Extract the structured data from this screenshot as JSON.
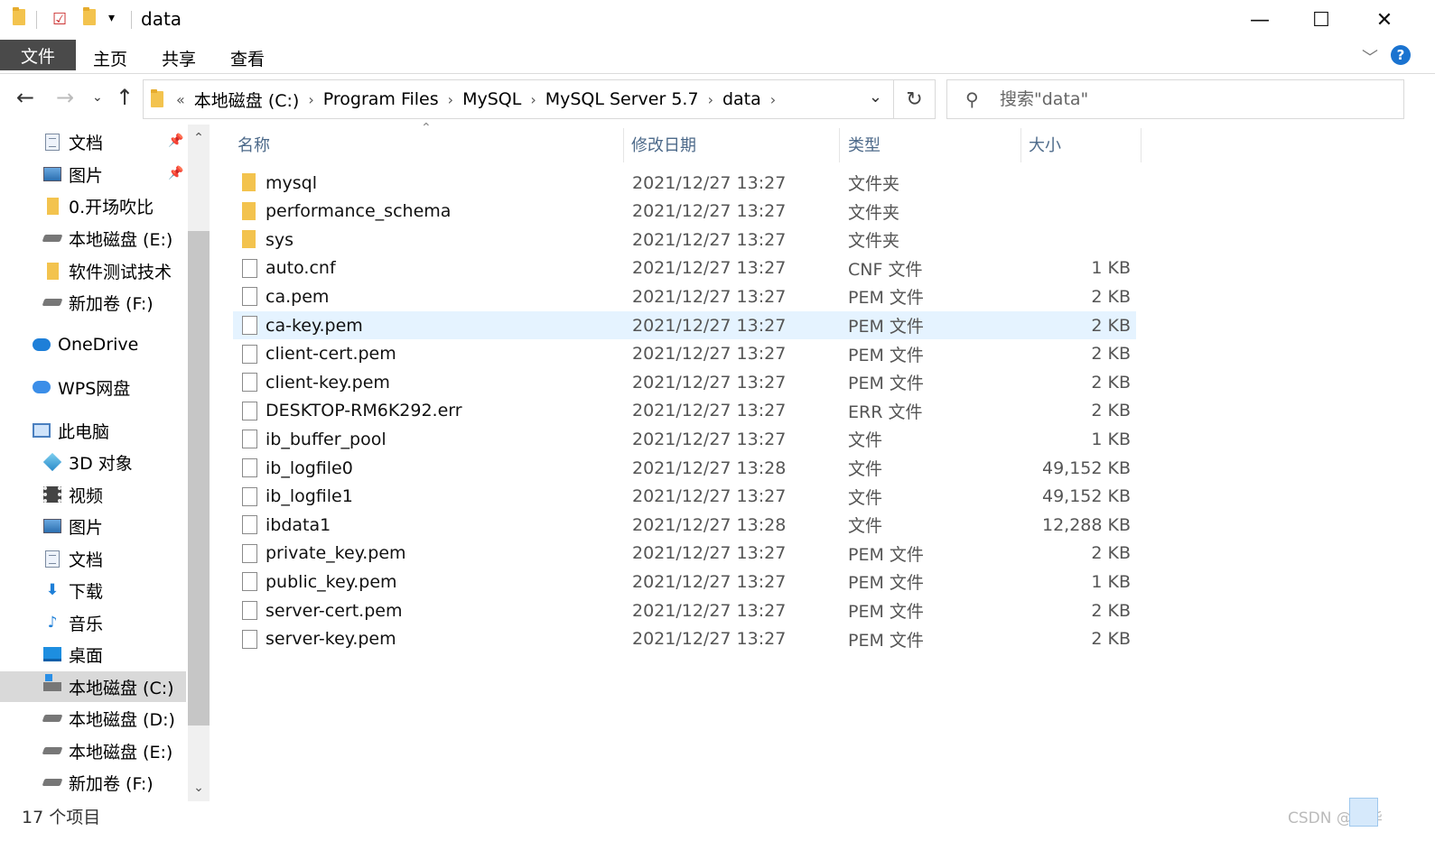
{
  "window": {
    "title": "data",
    "minimize_glyph": "—",
    "maximize_glyph": "☐",
    "close_glyph": "✕"
  },
  "ribbon": {
    "tabs": [
      "文件",
      "主页",
      "共享",
      "查看"
    ],
    "help_label": "?"
  },
  "nav": {
    "address_prefix": "«",
    "breadcrumb": [
      "本地磁盘 (C:)",
      "Program Files",
      "MySQL",
      "MySQL Server 5.7",
      "data"
    ],
    "search_placeholder": "搜索\"data\""
  },
  "sidebar": {
    "items": [
      {
        "label": "文档",
        "icon": "document-icon",
        "pinned": true
      },
      {
        "label": "图片",
        "icon": "pictures-icon",
        "pinned": true
      },
      {
        "label": "0.开场吹比",
        "icon": "folder-icon"
      },
      {
        "label": "本地磁盘 (E:)",
        "icon": "drive-icon"
      },
      {
        "label": "软件测试技术",
        "icon": "folder-icon"
      },
      {
        "label": "新加卷 (F:)",
        "icon": "drive-icon"
      },
      {
        "label": "OneDrive",
        "icon": "onedrive-cloud-icon"
      },
      {
        "label": "WPS网盘",
        "icon": "wps-cloud-icon"
      },
      {
        "label": "此电脑",
        "icon": "this-pc-icon"
      },
      {
        "label": "3D 对象",
        "icon": "3d-objects-icon"
      },
      {
        "label": "视频",
        "icon": "video-icon"
      },
      {
        "label": "图片",
        "icon": "pictures-icon"
      },
      {
        "label": "文档",
        "icon": "document-icon"
      },
      {
        "label": "下载",
        "icon": "download-icon"
      },
      {
        "label": "音乐",
        "icon": "music-icon"
      },
      {
        "label": "桌面",
        "icon": "desktop-icon"
      },
      {
        "label": "本地磁盘 (C:)",
        "icon": "windows-drive-icon",
        "selected": true
      },
      {
        "label": "本地磁盘 (D:)",
        "icon": "drive-icon"
      },
      {
        "label": "本地磁盘 (E:)",
        "icon": "drive-icon"
      },
      {
        "label": "新加卷 (F:)",
        "icon": "drive-icon"
      }
    ]
  },
  "columns": {
    "name": "名称",
    "date": "修改日期",
    "type": "类型",
    "size": "大小"
  },
  "files": [
    {
      "name": "mysql",
      "date": "2021/12/27 13:27",
      "type": "文件夹",
      "size": "",
      "kind": "folder"
    },
    {
      "name": "performance_schema",
      "date": "2021/12/27 13:27",
      "type": "文件夹",
      "size": "",
      "kind": "folder"
    },
    {
      "name": "sys",
      "date": "2021/12/27 13:27",
      "type": "文件夹",
      "size": "",
      "kind": "folder"
    },
    {
      "name": "auto.cnf",
      "date": "2021/12/27 13:27",
      "type": "CNF 文件",
      "size": "1 KB",
      "kind": "file"
    },
    {
      "name": "ca.pem",
      "date": "2021/12/27 13:27",
      "type": "PEM 文件",
      "size": "2 KB",
      "kind": "file"
    },
    {
      "name": "ca-key.pem",
      "date": "2021/12/27 13:27",
      "type": "PEM 文件",
      "size": "2 KB",
      "kind": "file",
      "highlighted": true
    },
    {
      "name": "client-cert.pem",
      "date": "2021/12/27 13:27",
      "type": "PEM 文件",
      "size": "2 KB",
      "kind": "file"
    },
    {
      "name": "client-key.pem",
      "date": "2021/12/27 13:27",
      "type": "PEM 文件",
      "size": "2 KB",
      "kind": "file"
    },
    {
      "name": "DESKTOP-RM6K292.err",
      "date": "2021/12/27 13:27",
      "type": "ERR 文件",
      "size": "2 KB",
      "kind": "file"
    },
    {
      "name": "ib_buffer_pool",
      "date": "2021/12/27 13:27",
      "type": "文件",
      "size": "1 KB",
      "kind": "file"
    },
    {
      "name": "ib_logfile0",
      "date": "2021/12/27 13:28",
      "type": "文件",
      "size": "49,152 KB",
      "kind": "file"
    },
    {
      "name": "ib_logfile1",
      "date": "2021/12/27 13:27",
      "type": "文件",
      "size": "49,152 KB",
      "kind": "file"
    },
    {
      "name": "ibdata1",
      "date": "2021/12/27 13:28",
      "type": "文件",
      "size": "12,288 KB",
      "kind": "file"
    },
    {
      "name": "private_key.pem",
      "date": "2021/12/27 13:27",
      "type": "PEM 文件",
      "size": "2 KB",
      "kind": "file"
    },
    {
      "name": "public_key.pem",
      "date": "2021/12/27 13:27",
      "type": "PEM 文件",
      "size": "1 KB",
      "kind": "file"
    },
    {
      "name": "server-cert.pem",
      "date": "2021/12/27 13:27",
      "type": "PEM 文件",
      "size": "2 KB",
      "kind": "file"
    },
    {
      "name": "server-key.pem",
      "date": "2021/12/27 13:27",
      "type": "PEM 文件",
      "size": "2 KB",
      "kind": "file"
    }
  ],
  "status": {
    "item_count": "17 个项目",
    "watermark": "CSDN @栖毕"
  },
  "colors": {
    "file_tab_bg": "#4a4a4a",
    "selection_bg": "#d9d9d9",
    "hover_bg": "#e5f3ff",
    "help_blue": "#1a73d0",
    "header_text": "#4d6a8a"
  }
}
